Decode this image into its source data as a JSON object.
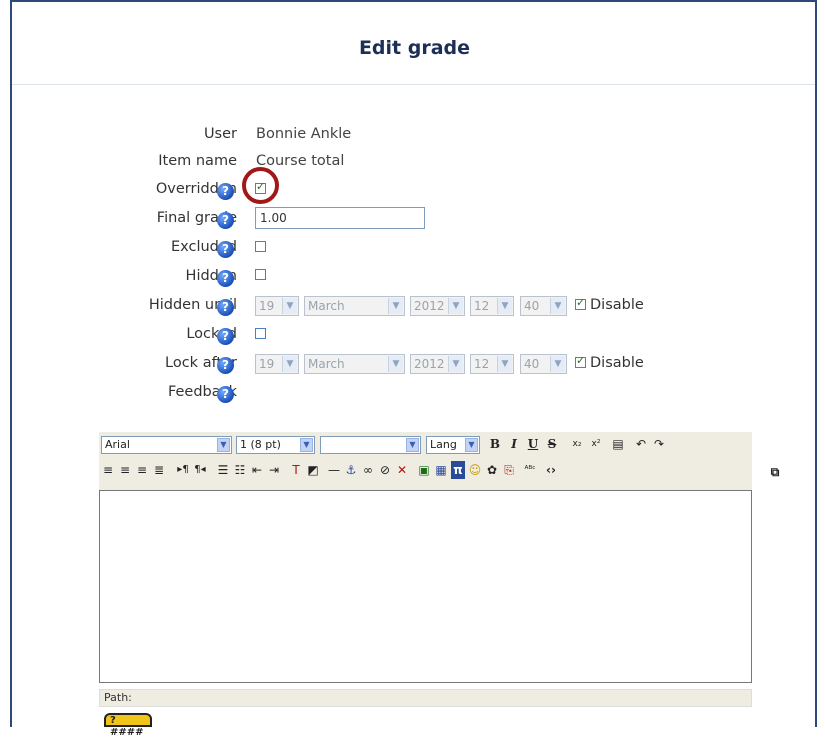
{
  "title": "Edit grade",
  "fields": {
    "user_label": "User",
    "user_value": "Bonnie Ankle",
    "item_label": "Item name",
    "item_value": "Course total",
    "overridden_label": "Overridden",
    "overridden_checked": true,
    "final_grade_label": "Final grade",
    "final_grade_value": "1.00",
    "excluded_label": "Excluded",
    "hidden_label": "Hidden",
    "hidden_until_label": "Hidden until",
    "locked_label": "Locked",
    "lock_after_label": "Lock after",
    "feedback_label": "Feedback",
    "help_glyph": "?"
  },
  "date_selects": {
    "day": "19",
    "month": "March",
    "year": "2012",
    "hour": "12",
    "minute": "40",
    "disable_label": "Disable",
    "disable_checked": true
  },
  "editor": {
    "font": "Arial",
    "size": "1 (8 pt)",
    "style": "",
    "lang": "Lang",
    "path_label": "Path:",
    "help_badge": "? ####"
  },
  "colors": {
    "frame": "#2b4a78",
    "title": "#1c2f57",
    "highlight_circle": "#a01818",
    "toolbar_bg": "#efede2"
  }
}
